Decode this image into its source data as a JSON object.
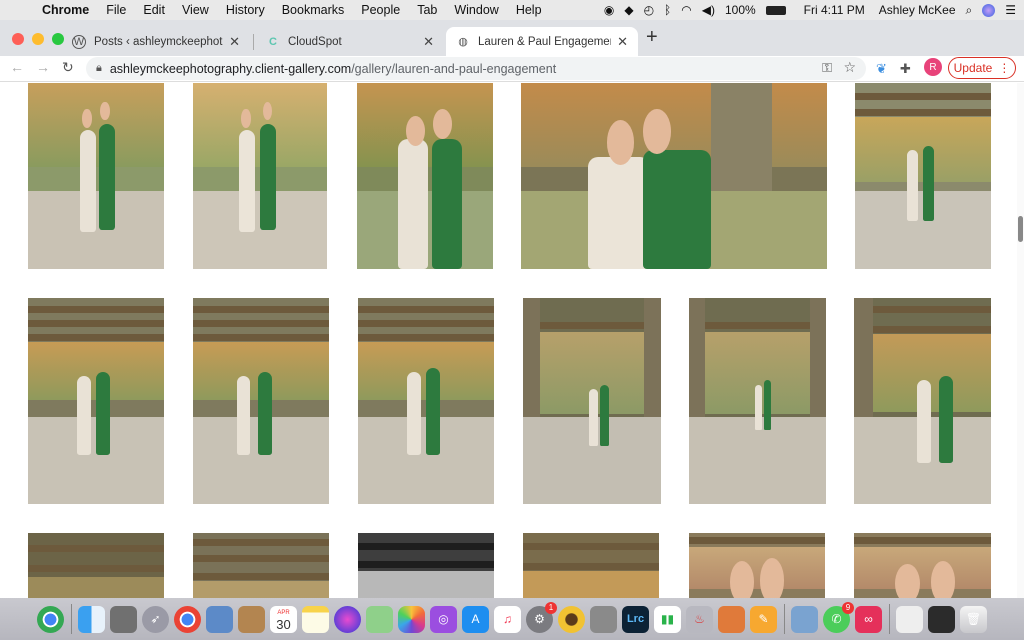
{
  "menubar": {
    "app": "Chrome",
    "items": [
      "File",
      "Edit",
      "View",
      "History",
      "Bookmarks",
      "People",
      "Tab",
      "Window",
      "Help"
    ],
    "battery": "100%",
    "clock": "Fri 4:11 PM",
    "user": "Ashley McKee"
  },
  "tabs": [
    {
      "title": "Posts ‹ ashleymckeephotograp",
      "favicon": "wordpress-icon"
    },
    {
      "title": "CloudSpot",
      "favicon": "cloudspot-icon"
    },
    {
      "title": "Lauren & Paul Engagement",
      "favicon": "globe-icon"
    }
  ],
  "address": {
    "host": "ashleymckeephotography.client-gallery.com",
    "path": "/gallery/lauren-and-paul-engagement"
  },
  "update_label": "Update",
  "avatar_letter": "R",
  "dock": {
    "calendar_day": "30",
    "calendar_month": "APR",
    "lightroom_label": "Lrc",
    "badges": {
      "system_prefs": "1",
      "facetime": "9"
    }
  }
}
